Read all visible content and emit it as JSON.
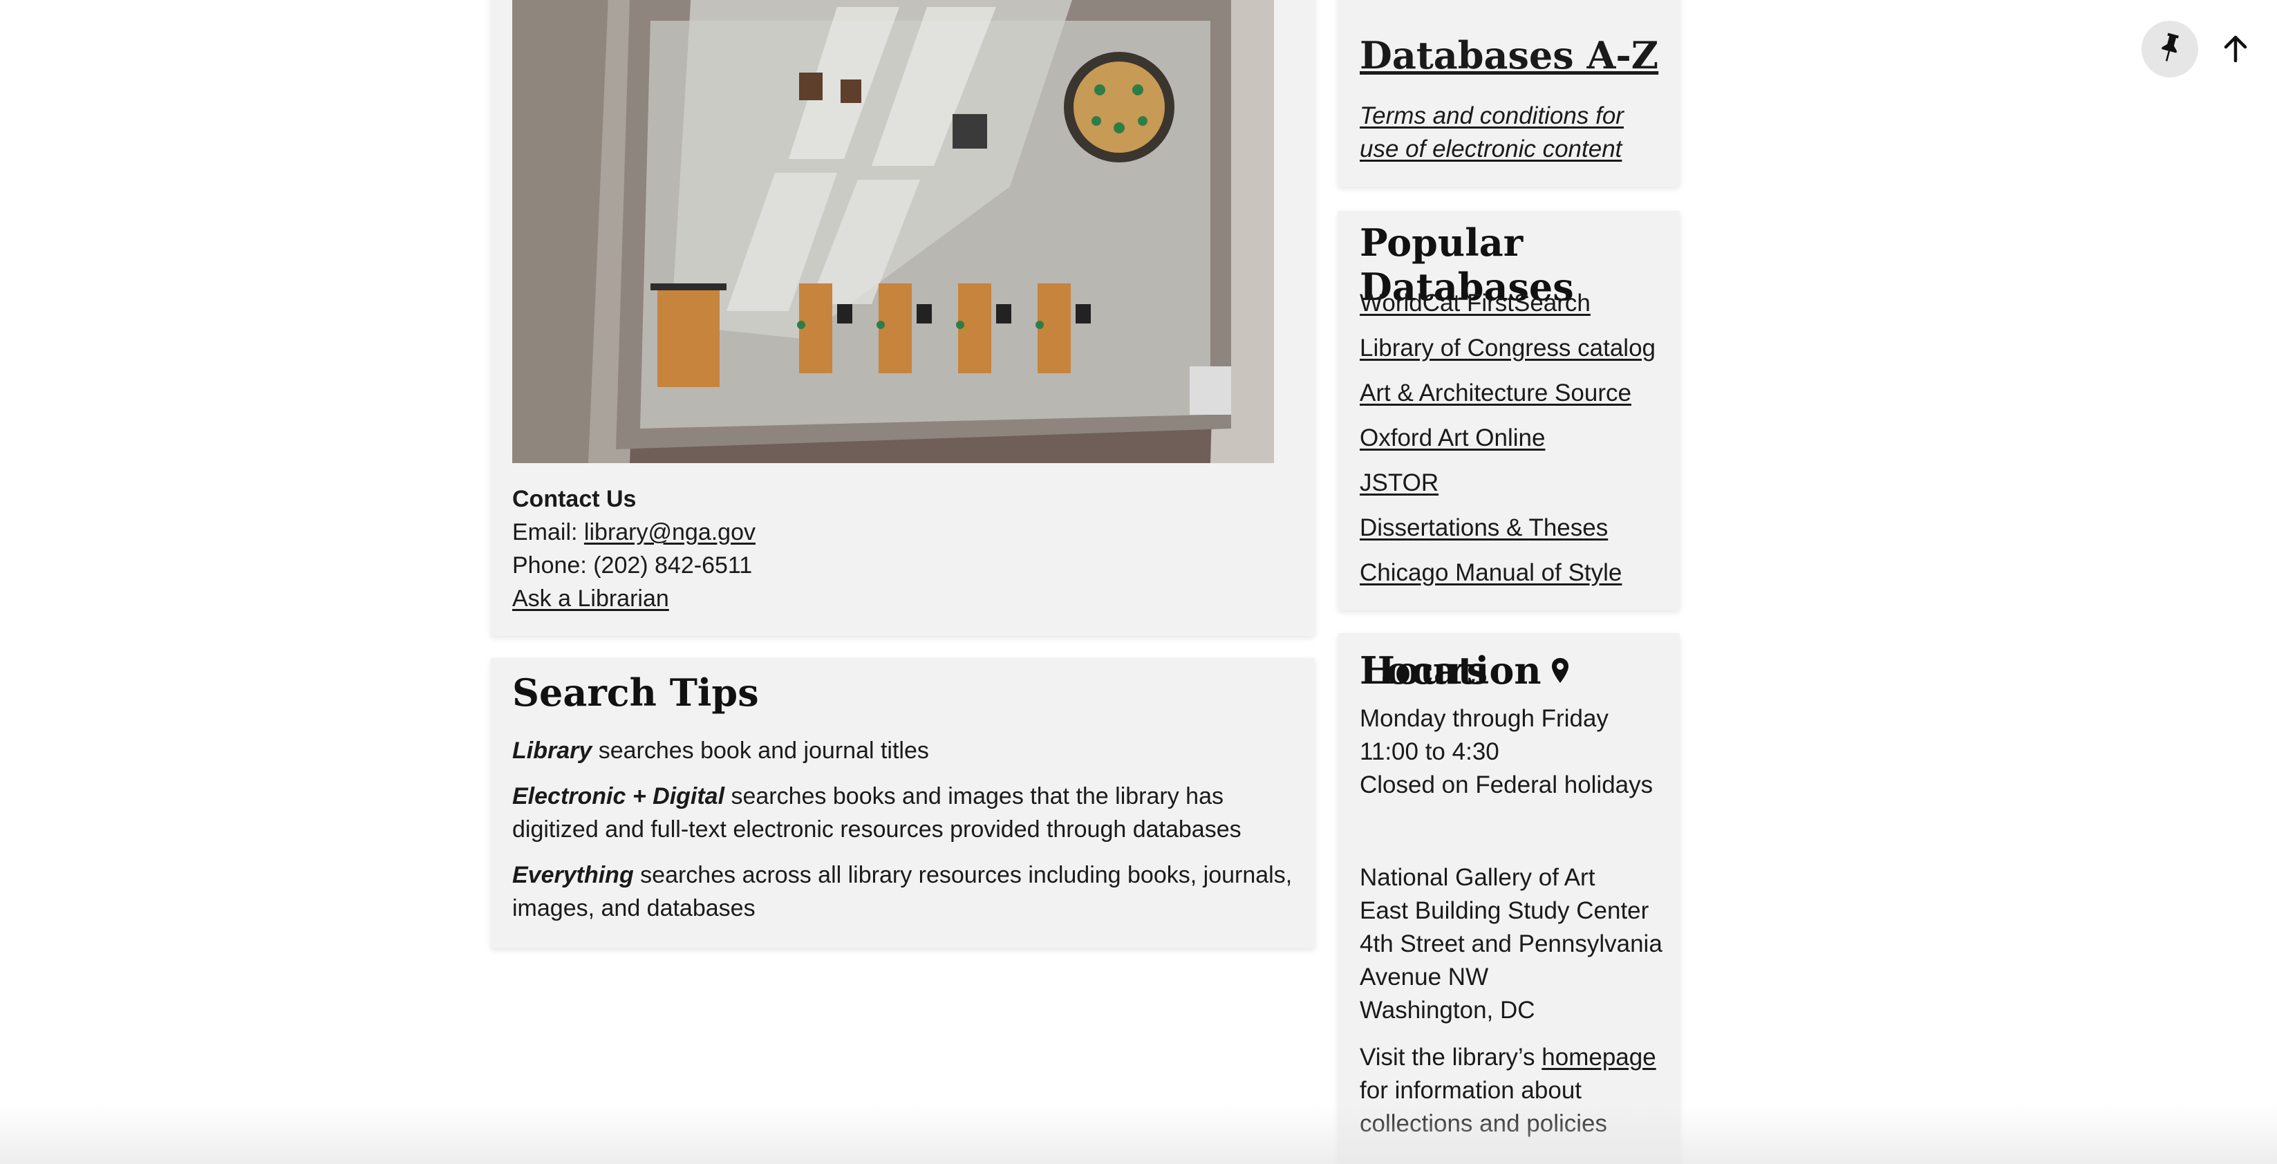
{
  "contact": {
    "title": "Contact Us",
    "email_label": "Email: ",
    "email": "library@nga.gov",
    "phone": "Phone: (202) 842-6511",
    "ask_link": "Ask a Librarian"
  },
  "search_tips": {
    "heading": "Search Tips",
    "tips": [
      {
        "term": "Library",
        "text": " searches book and journal titles"
      },
      {
        "term": "Electronic + Digital",
        "text": " searches books and images that the library has digitized and full-text electronic resources provided through databases"
      },
      {
        "term": "Everything",
        "text": " searches across all library resources including books, journals, images, and databases"
      }
    ]
  },
  "sidebar": {
    "az_heading": "Databases A-Z",
    "terms_link": "Terms and conditions for use of electronic content",
    "popular_heading": "Popular Databases",
    "popular": [
      "WorldCat FirstSearch",
      "Library of Congress catalog",
      "Art & Architecture Source",
      "Oxford Art Online",
      "JSTOR",
      "Dissertations & Theses",
      "Chicago Manual of Style"
    ],
    "hours_heading": "Hours",
    "hours_line1": "Monday through Friday 11:00 to 4:30",
    "hours_line2": "Closed on Federal holidays",
    "location_heading": "Location",
    "address": [
      "National Gallery of Art",
      "East Building Study Center",
      "4th Street and Pennsylvania Avenue NW",
      "Washington, DC"
    ],
    "visit_prefix": "Visit the library’s ",
    "visit_link": "homepage",
    "visit_suffix": " for information about collections and policies"
  },
  "icons": {
    "pin": "pushpin-icon",
    "back_to_top": "arrow-up-icon",
    "location": "map-marker-icon"
  }
}
